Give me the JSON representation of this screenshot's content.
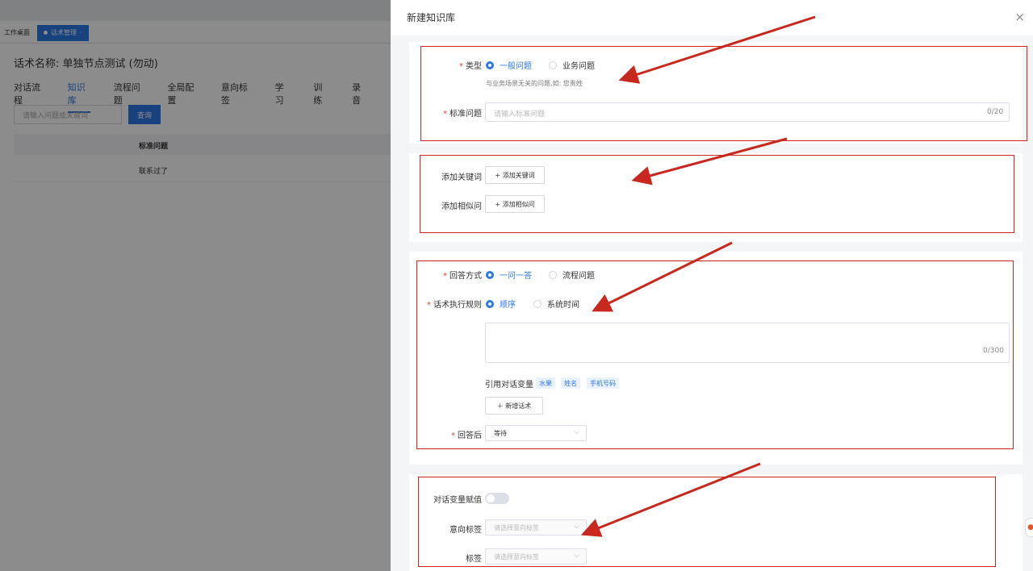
{
  "background": {
    "home_tab": "工作桌面",
    "active_tab": "话术管理",
    "title": "话术名称: 单独节点测试 (勿动)",
    "nav_tabs": [
      "对话流程",
      "知识库",
      "流程问题",
      "全局配置",
      "意向标签",
      "学习",
      "训练",
      "录音"
    ],
    "search_placeholder": "请输入问题或关键词",
    "search_button": "查询",
    "table_header": "标准问题",
    "table_rows": [
      "联系过了"
    ]
  },
  "drawer": {
    "title": "新建知识库",
    "close_icon": "×",
    "type": {
      "label": "类型",
      "options": [
        "一般问题",
        "业务问题"
      ],
      "selected": "一般问题",
      "hint": "与业务场景无关的问题,如: 您贵姓"
    },
    "standard_question": {
      "label": "标准问题",
      "placeholder": "请输入标准问题",
      "counter": "0/20"
    },
    "keywords": {
      "label": "添加关键词",
      "button": "+ 添加关键词"
    },
    "similar": {
      "label": "添加相似问",
      "button": "+ 添加相似问"
    },
    "answer_mode": {
      "label": "回答方式",
      "options": [
        "一问一答",
        "流程问题"
      ],
      "selected": "一问一答"
    },
    "exec_rule": {
      "label": "话术执行规则",
      "options": [
        "顺序",
        "系统时间"
      ],
      "selected": "顺序"
    },
    "script_text": {
      "counter": "0/300"
    },
    "variables": {
      "label": "引用对话变量",
      "tags": [
        "水果",
        "姓名",
        "手机号码"
      ]
    },
    "add_script_button": "＋ 新增话术",
    "after_answer": {
      "label": "回答后",
      "value": "等待"
    },
    "var_assign": {
      "label": "对话变量赋值",
      "enabled": false
    },
    "intent_tag": {
      "label": "意向标签",
      "placeholder": "请选择意向标签"
    },
    "tag": {
      "label": "标签",
      "placeholder": "请选择意向标签"
    }
  },
  "annotations": {
    "color": "#c8281e"
  }
}
